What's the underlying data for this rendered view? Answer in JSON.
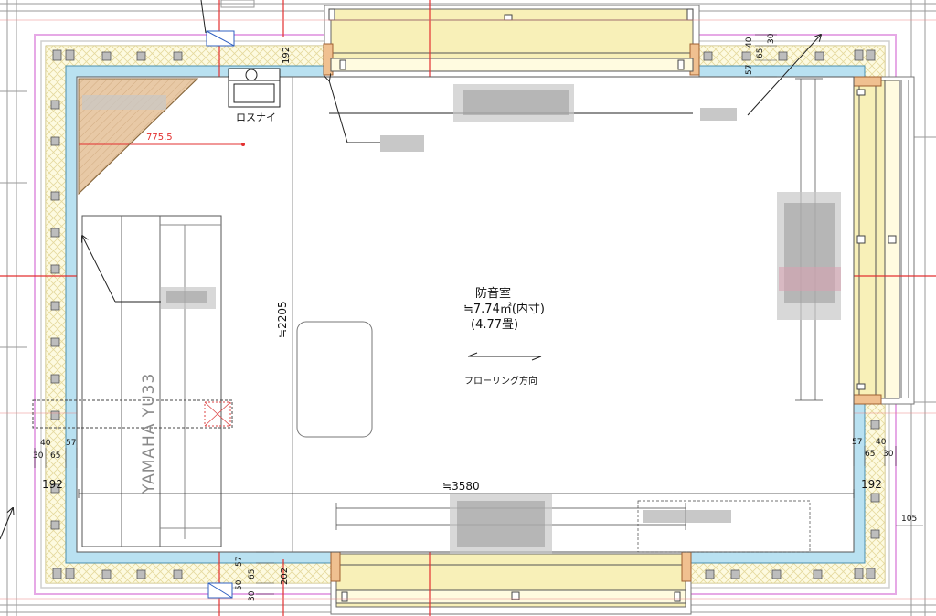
{
  "room": {
    "name": "防音室",
    "area": "≒7.74㎡(内寸)",
    "tatami": "(4.77畳)",
    "flooring_direction": "フローリング方向"
  },
  "dimensions": {
    "width_inner": "≒3580",
    "depth_inner": "≒2205",
    "wall_total_top": "192",
    "wall_total_left": "192",
    "wall_total_right": "192",
    "wall_total_bottom": "202",
    "counter_width": "775.5",
    "right_offset": "105",
    "layers_top_right": [
      "40",
      "65",
      "30",
      "57"
    ],
    "layers_left": [
      "40",
      "30",
      "65",
      "57"
    ],
    "layers_right": [
      "57",
      "40",
      "65",
      "30"
    ],
    "layers_bottom": [
      "57",
      "50",
      "65",
      "30"
    ]
  },
  "labels": {
    "ventilation": "ロスナイ",
    "piano": "YAMAHA  YU33"
  },
  "colors": {
    "insulation_blue": "#b9e1f1",
    "wall_yellow": "#fbf6c6",
    "outer_pink": "#e6a9e6",
    "window_yellow": "#f8f0b8",
    "counter_tan": "#e8c9a6",
    "gridline_red": "#e33030",
    "gray_line": "#8a8a8a"
  }
}
